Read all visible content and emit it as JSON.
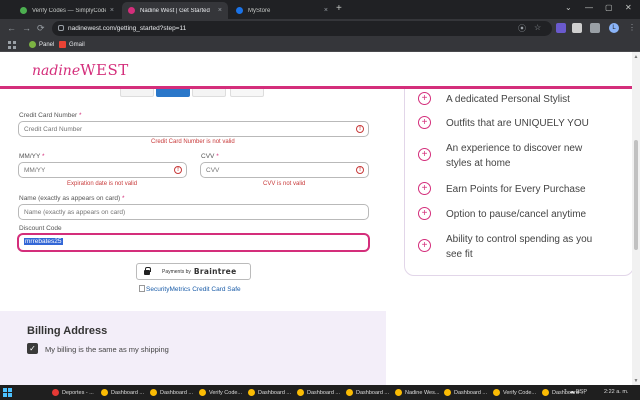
{
  "browser": {
    "tabs": [
      {
        "title": "Verify Codes — SimplyCodes",
        "active": false,
        "favicon_color": "#4caf50"
      },
      {
        "title": "Nadine West | Get Started",
        "active": true,
        "favicon_color": "#d42e7b"
      },
      {
        "title": "MyStore",
        "active": false,
        "favicon_color": "#1a73e8"
      }
    ],
    "new_tab": "+",
    "close_glyph": "×",
    "window_controls": {
      "minimize": "—",
      "maximize": "▢",
      "close": "✕",
      "tab_search": "⌄"
    },
    "url": "nadinewest.com/getting_started?step=11",
    "nav": {
      "back": "←",
      "forward": "→",
      "reload": "⟳"
    },
    "omni_icons": {
      "location": "⦿",
      "star": "☆",
      "menu": "⋮"
    },
    "profile_initial": "L",
    "bookmarks": [
      {
        "label": "Panel",
        "icon_color": "#7cb342"
      },
      {
        "label": "Gmail",
        "icon_color": "#ea4335"
      }
    ]
  },
  "site": {
    "logo_part1": "nadine",
    "logo_part2": "WEST",
    "brand_color": "#d42e7b"
  },
  "payment": {
    "card_number": {
      "label": "Credit Card Number",
      "required": "*",
      "placeholder": "Credit Card Number",
      "error": "Credit Card Number is not valid"
    },
    "expiry": {
      "label": "MM/YY",
      "required": "*",
      "placeholder": "MM/YY",
      "error": "Expiration date is not valid"
    },
    "cvv": {
      "label": "CVV",
      "required": "*",
      "placeholder": "CVV",
      "error": "CVV is not valid"
    },
    "name": {
      "label": "Name (exactly as appears on card)",
      "required": "*",
      "placeholder": "Name (exactly as appears on card)"
    },
    "discount": {
      "label": "Discount Code",
      "value": "mrrebates25"
    },
    "error_icon": "!",
    "braintree": {
      "prefix": "Payments by",
      "name": "Braintree"
    },
    "security_badge_alt": "SecurityMetrics Credit Card Safe"
  },
  "billing": {
    "title": "Billing Address",
    "same_as_shipping_label": "My billing is the same as my shipping",
    "same_as_shipping_checked": true,
    "check_glyph": "✓"
  },
  "benefits": {
    "plus_glyph": "+",
    "items": [
      "A dedicated Personal Stylist",
      "Outfits that are UNIQUELY YOU",
      "An experience to discover new styles at home",
      "Earn Points for Every Purchase",
      "Option to pause/cancel anytime",
      "Ability to control spending as you see fit"
    ]
  },
  "taskbar": {
    "items": [
      {
        "label": "Deportes - ...",
        "icon_color": "#e53935"
      },
      {
        "label": "Dashboard ...",
        "icon_color": "#fbbc04"
      },
      {
        "label": "Dashboard ...",
        "icon_color": "#fbbc04"
      },
      {
        "label": "Verify Code...",
        "icon_color": "#fbbc04"
      },
      {
        "label": "Dashboard ...",
        "icon_color": "#fbbc04"
      },
      {
        "label": "Dashboard ...",
        "icon_color": "#fbbc04"
      },
      {
        "label": "Dashboard ...",
        "icon_color": "#fbbc04"
      },
      {
        "label": "Nadine Wes...",
        "icon_color": "#fbbc04"
      },
      {
        "label": "Dashboard ...",
        "icon_color": "#fbbc04"
      },
      {
        "label": "Verify Code...",
        "icon_color": "#fbbc04"
      },
      {
        "label": "Dashboard ...",
        "icon_color": "#fbbc04"
      }
    ],
    "language": "ESP",
    "time": "2:22 a. m."
  }
}
